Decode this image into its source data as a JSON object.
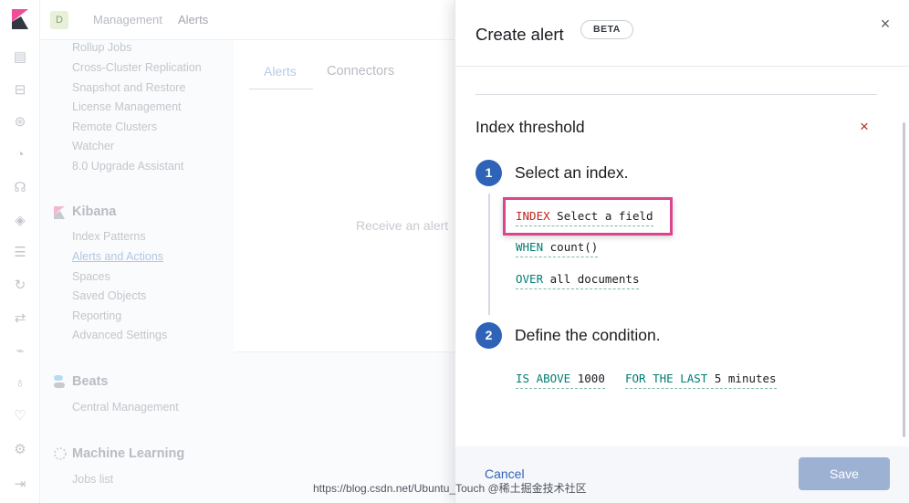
{
  "colors": {
    "primary": "#2f63b8",
    "danger": "#bd271e",
    "accent_keyword": "#017d73",
    "highlight": "#d9468d"
  },
  "header": {
    "space_initial": "D",
    "breadcrumbs": [
      "Management",
      "Alerts"
    ]
  },
  "nav_icons": [
    "kibana-logo-icon",
    "dashboard-icon",
    "briefcase-icon",
    "map-icon",
    "gauge-icon",
    "graph-icon",
    "shield-icon",
    "stack-icon",
    "apm-icon",
    "uptime-icon",
    "logs-icon",
    "metrics-icon",
    "heartbeat-icon",
    "gear-icon",
    "collapse-icon"
  ],
  "sidebar": {
    "elasticsearch_links": [
      "Rollup Jobs",
      "Cross-Cluster Replication",
      "Snapshot and Restore",
      "License Management",
      "Remote Clusters",
      "Watcher",
      "8.0 Upgrade Assistant"
    ],
    "kibana": {
      "title": "Kibana",
      "links": [
        "Index Patterns",
        "Alerts and Actions",
        "Spaces",
        "Saved Objects",
        "Reporting",
        "Advanced Settings"
      ]
    },
    "beats": {
      "title": "Beats",
      "links": [
        "Central Management"
      ]
    },
    "ml": {
      "title": "Machine Learning",
      "links": [
        "Jobs list"
      ]
    }
  },
  "main": {
    "tabs": [
      "Alerts",
      "Connectors"
    ],
    "empty_text": "Receive an alert"
  },
  "flyout": {
    "title": "Create alert",
    "badge": "BETA",
    "alert_type_title": "Index threshold",
    "steps": [
      {
        "number": "1",
        "title": "Select an index."
      },
      {
        "number": "2",
        "title": "Define the condition."
      }
    ],
    "expressions": {
      "index": {
        "keyword": "INDEX",
        "value": "Select a field"
      },
      "when": {
        "keyword": "WHEN",
        "value": "count()"
      },
      "over": {
        "keyword": "OVER",
        "value": "all documents"
      },
      "is_above": {
        "keyword": "IS ABOVE",
        "value": "1000"
      },
      "for_the_last": {
        "keyword": "FOR THE LAST",
        "value": "5 minutes"
      }
    },
    "footer": {
      "cancel_label": "Cancel",
      "save_label": "Save"
    }
  },
  "watermark": "https://blog.csdn.net/Ubuntu_Touch @稀土掘金技术社区"
}
